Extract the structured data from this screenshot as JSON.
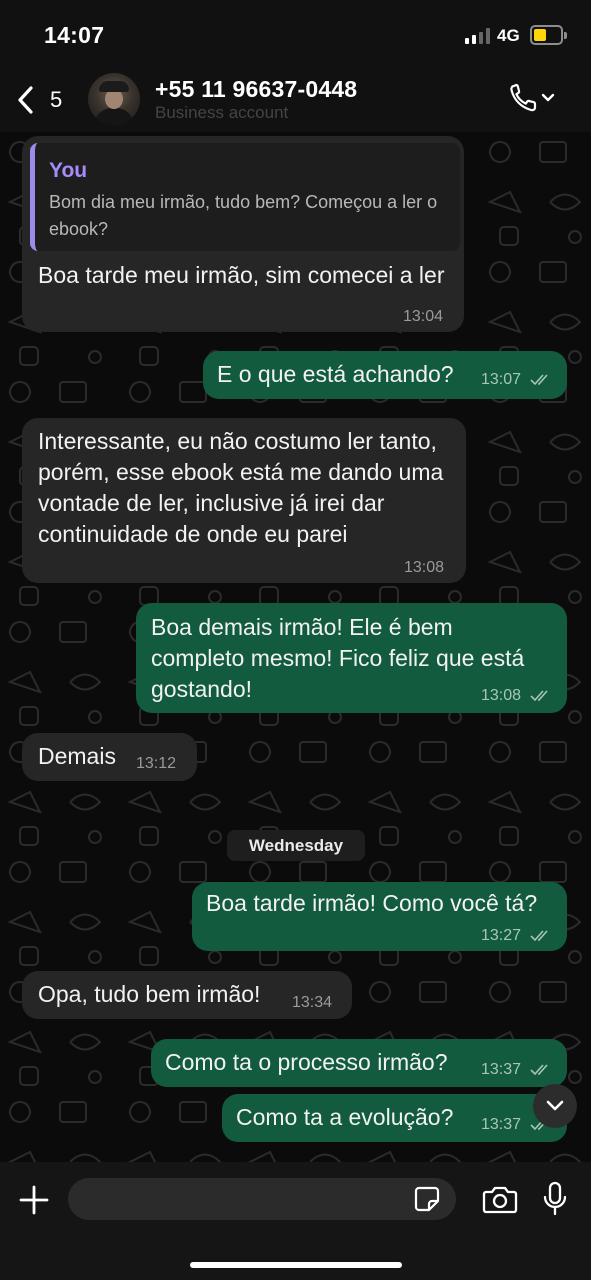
{
  "status_bar": {
    "time": "14:07",
    "network": "4G"
  },
  "header": {
    "back_count": "5",
    "contact_name": "+55 11 96637-0448",
    "subtitle": "Business account"
  },
  "quoted": {
    "author": "You",
    "text": "Bom dia meu irmão, tudo bem? Começou a ler o ebook?"
  },
  "messages": [
    {
      "dir": "in",
      "text": "Boa tarde meu irmão, sim comecei a ler",
      "time": "13:04"
    },
    {
      "dir": "out",
      "text": "E o que está achando?",
      "time": "13:07"
    },
    {
      "dir": "in",
      "text": "Interessante, eu não costumo ler tanto, porém, esse ebook está me dando uma vontade de ler, inclusive já irei dar continuidade de onde eu parei",
      "time": "13:08"
    },
    {
      "dir": "out",
      "text": "Boa demais irmão! Ele é bem completo mesmo! Fico feliz que está gostando!",
      "time": "13:08"
    },
    {
      "dir": "in",
      "text": "Demais",
      "time": "13:12"
    },
    {
      "dir": "out",
      "text": "Boa tarde irmão! Como você tá?",
      "time": "13:27"
    },
    {
      "dir": "in",
      "text": "Opa, tudo bem irmão!",
      "time": "13:34"
    },
    {
      "dir": "out",
      "text": "Como ta o processo irmão?",
      "time": "13:37"
    },
    {
      "dir": "out",
      "text": "Como ta a evolução?",
      "time": "13:37"
    }
  ],
  "date_separator": "Wednesday",
  "composer": {
    "placeholder": ""
  },
  "colors": {
    "incoming_bubble": "#262626",
    "outgoing_bubble": "#125b3f",
    "quote_accent": "#a78bfa",
    "background": "#0b0b0b"
  }
}
